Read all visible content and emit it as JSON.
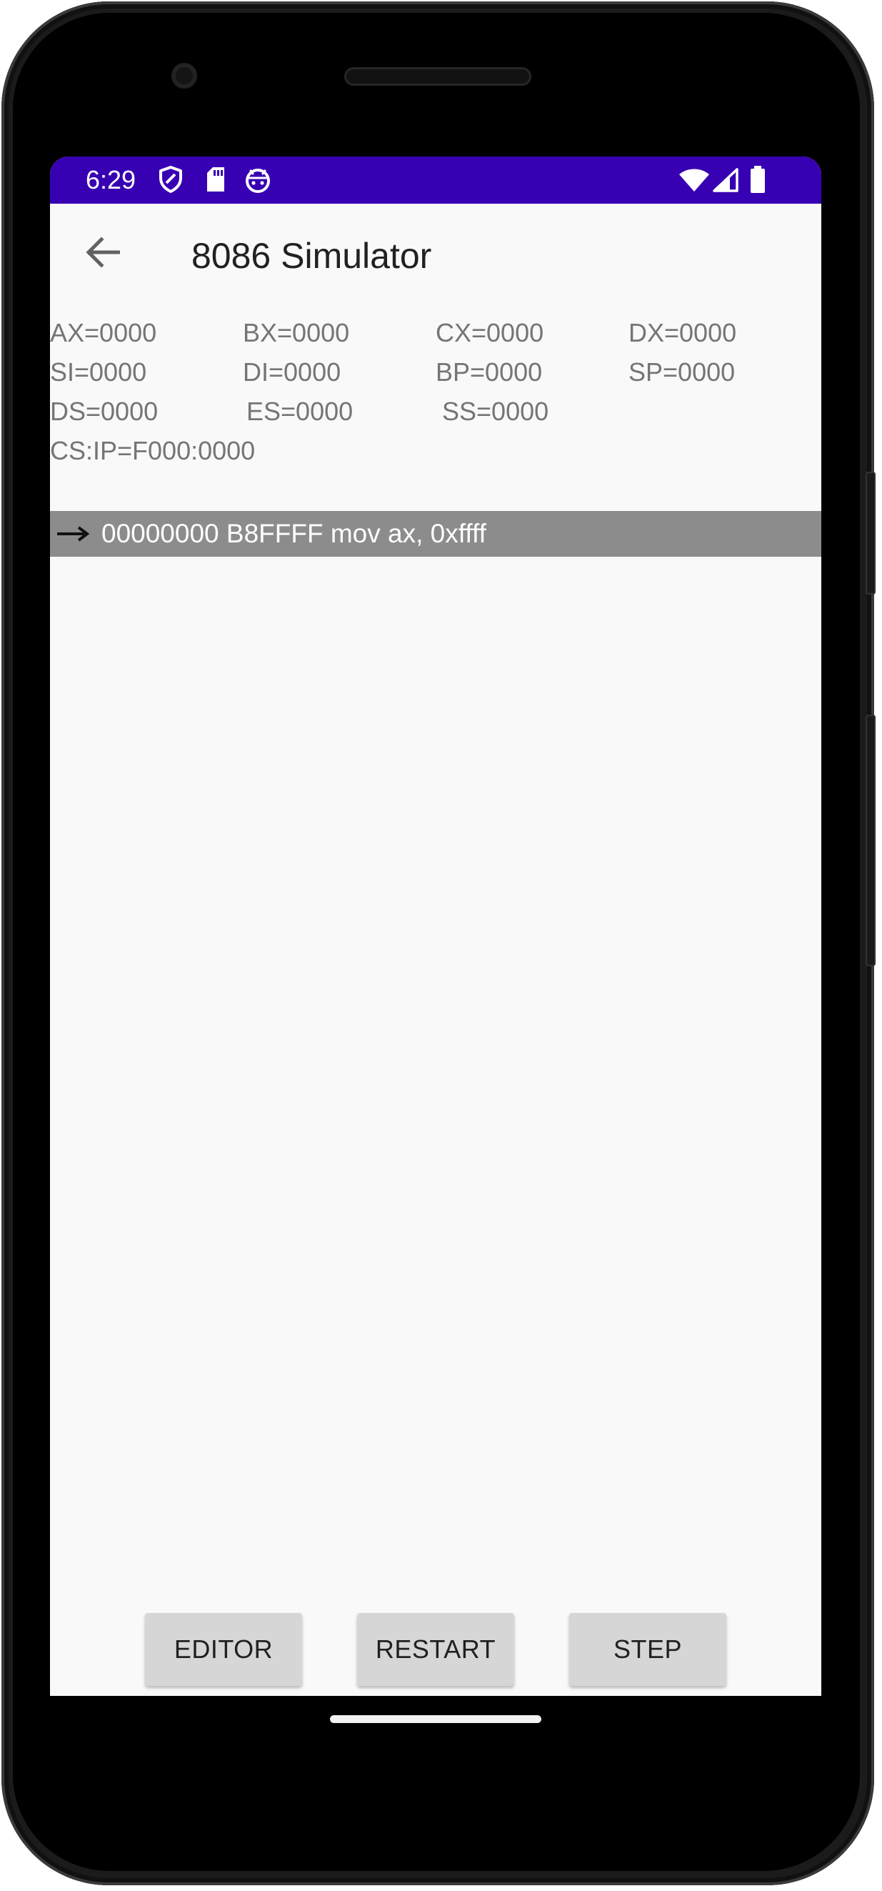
{
  "status_bar": {
    "time": "6:29",
    "left_icons": [
      "shield-icon",
      "sd-card-icon",
      "android-face-icon"
    ],
    "right_icons": [
      "wifi-icon",
      "cell-signal-icon",
      "battery-icon"
    ],
    "color": "#3700b3"
  },
  "app_bar": {
    "back_icon": "arrow-back-icon",
    "title": "8086 Simulator"
  },
  "registers": {
    "ax": "AX=0000",
    "bx": "BX=0000",
    "cx": "CX=0000",
    "dx": "DX=0000",
    "si": "SI=0000",
    "di": "DI=0000",
    "bp": "BP=0000",
    "sp": "SP=0000",
    "ds": "DS=0000",
    "es": "ES=0000",
    "ss": "SS=0000",
    "cs_ip": "CS:IP=F000:0000"
  },
  "code_listing": [
    {
      "pointer_icon": "long-right-arrow-icon",
      "text": "00000000 B8FFFF mov ax, 0xffff",
      "current": true
    }
  ],
  "buttons": {
    "editor": "EDITOR",
    "restart": "RESTART",
    "step": "STEP"
  },
  "colors": {
    "primary_dark": "#3700b3",
    "highlight_row": "#8c8c8c",
    "button_bg": "#d6d6d6",
    "background": "#f9f9f9"
  }
}
